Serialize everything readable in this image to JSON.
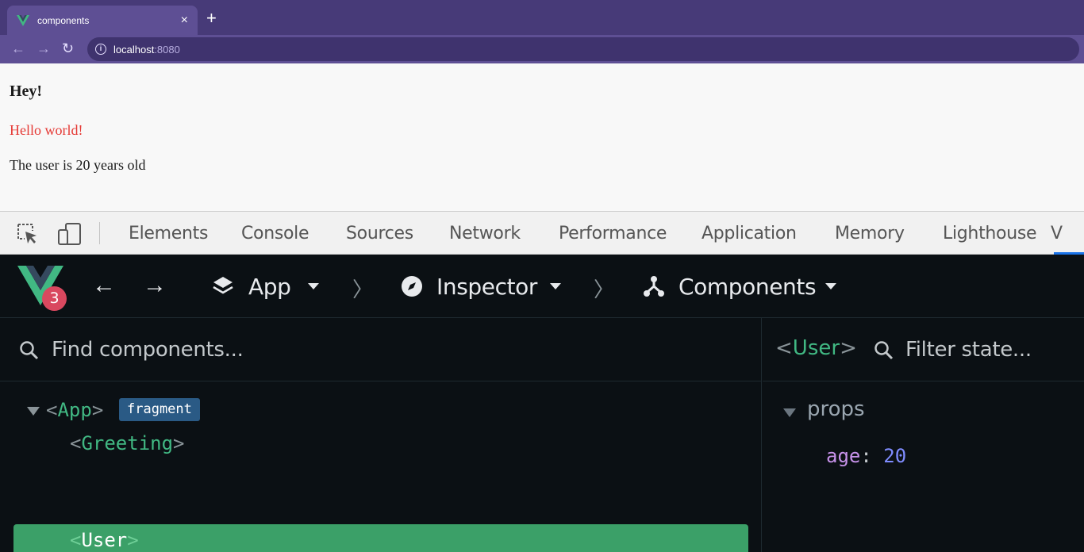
{
  "browser": {
    "tab_title": "components",
    "tab_close": "×",
    "new_tab": "+",
    "url_host": "localhost",
    "url_port": ":8080",
    "colors": {
      "chrome": "#473a78",
      "tab": "#5e4f94"
    }
  },
  "page": {
    "heading": "Hey!",
    "greeting": "Hello world!",
    "age_text": "The user is 20 years old",
    "greeting_color": "#e53935"
  },
  "devtools": {
    "tabs": [
      "Elements",
      "Console",
      "Sources",
      "Network",
      "Performance",
      "Application",
      "Memory",
      "Lighthouse",
      "V"
    ]
  },
  "vue": {
    "version_badge": "3",
    "nav_back": "←",
    "nav_forward": "→",
    "app_label": "App",
    "sep": "〉",
    "inspector_label": "Inspector",
    "components_label": "Components",
    "search_placeholder": "Find components...",
    "tree": {
      "app_open": "<",
      "app_name": "App",
      "app_close": ">",
      "fragment_badge": "fragment",
      "greeting_open": "<",
      "greeting_name": "Greeting",
      "greeting_close": ">",
      "user_open": "<",
      "user_name": "User",
      "user_close": ">"
    },
    "state": {
      "comp_open": "<",
      "comp_name": "User",
      "comp_close": ">",
      "filter_placeholder": "Filter state...",
      "section": "props",
      "prop_key": "age",
      "prop_colon": ":",
      "prop_value": "20"
    },
    "colors": {
      "accent": "#41b883",
      "selected": "#3ba068",
      "badge": "#d9485f"
    }
  }
}
